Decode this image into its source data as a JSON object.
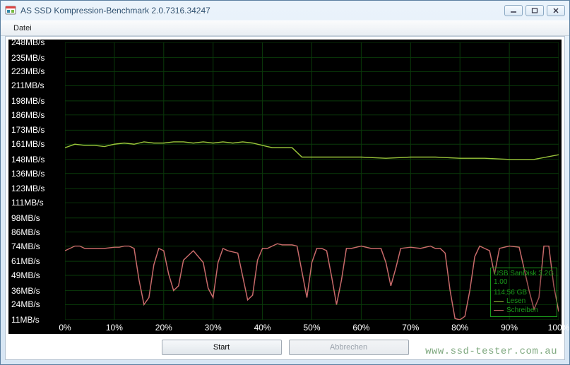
{
  "window": {
    "title": "AS SSD Kompression-Benchmark 2.0.7316.34247"
  },
  "menu": {
    "file": "Datei"
  },
  "buttons": {
    "start": "Start",
    "abort": "Abbrechen"
  },
  "legend": {
    "device": "USB  SanDisk 3.2G",
    "firmware": "1.00",
    "capacity": "114,56 GB",
    "read": "Lesen",
    "write": "Schreiben",
    "read_color": "#9ac53a",
    "write_color": "#c86a6a"
  },
  "watermark": "www.ssd-tester.com.au",
  "chart_data": {
    "type": "line",
    "xlabel": "",
    "ylabel": "",
    "x_unit": "%",
    "y_unit": "MB/s",
    "ylim": [
      11,
      248
    ],
    "xlim": [
      0,
      100
    ],
    "y_ticks": [
      11,
      24,
      36,
      49,
      61,
      74,
      86,
      98,
      111,
      123,
      136,
      148,
      161,
      173,
      186,
      198,
      211,
      223,
      235,
      248
    ],
    "y_tick_labels": [
      "11MB/s",
      "24MB/s",
      "36MB/s",
      "49MB/s",
      "61MB/s",
      "74MB/s",
      "86MB/s",
      "98MB/s",
      "111MB/s",
      "123MB/s",
      "136MB/s",
      "148MB/s",
      "161MB/s",
      "173MB/s",
      "186MB/s",
      "198MB/s",
      "211MB/s",
      "223MB/s",
      "235MB/s",
      "248MB/s"
    ],
    "x_ticks": [
      0,
      10,
      20,
      30,
      40,
      50,
      60,
      70,
      80,
      90,
      100
    ],
    "x_tick_labels": [
      "0%",
      "10%",
      "20%",
      "30%",
      "40%",
      "50%",
      "60%",
      "70%",
      "80%",
      "90%",
      "100%"
    ],
    "series": [
      {
        "name": "Lesen",
        "color": "#9ac53a",
        "x": [
          0,
          2,
          4,
          6,
          8,
          10,
          12,
          14,
          16,
          18,
          20,
          22,
          24,
          26,
          28,
          30,
          32,
          34,
          36,
          38,
          40,
          42,
          44,
          46,
          48,
          50,
          55,
          60,
          65,
          70,
          75,
          80,
          85,
          90,
          95,
          100
        ],
        "values": [
          158,
          161,
          160,
          160,
          159,
          161,
          162,
          161,
          163,
          162,
          162,
          163,
          163,
          162,
          163,
          162,
          163,
          162,
          163,
          162,
          160,
          158,
          158,
          158,
          150,
          150,
          150,
          150,
          149,
          150,
          150,
          149,
          149,
          148,
          148,
          152
        ]
      },
      {
        "name": "Schreiben",
        "color": "#c86a6a",
        "x": [
          0,
          2,
          3,
          4,
          5,
          6,
          8,
          10,
          11,
          12,
          13,
          14,
          15,
          16,
          17,
          18,
          19,
          20,
          21,
          22,
          23,
          24,
          26,
          28,
          29,
          30,
          31,
          32,
          33,
          35,
          36,
          37,
          38,
          39,
          40,
          41,
          42,
          43,
          44,
          45,
          46,
          47,
          48,
          49,
          50,
          51,
          52,
          53,
          54,
          55,
          56,
          57,
          58,
          60,
          62,
          64,
          65,
          66,
          67,
          68,
          70,
          72,
          74,
          75,
          76,
          77,
          78,
          79,
          80,
          81,
          82,
          83,
          84,
          85,
          86,
          87,
          88,
          90,
          92,
          94,
          95,
          96,
          97,
          98,
          99,
          100
        ],
        "values": [
          70,
          74,
          74,
          72,
          72,
          72,
          72,
          73,
          73,
          74,
          74,
          72,
          45,
          24,
          30,
          58,
          72,
          70,
          50,
          36,
          40,
          62,
          70,
          60,
          38,
          30,
          60,
          72,
          70,
          68,
          48,
          28,
          32,
          62,
          72,
          72,
          74,
          76,
          75,
          75,
          75,
          74,
          52,
          30,
          60,
          72,
          72,
          70,
          48,
          24,
          45,
          72,
          72,
          74,
          72,
          72,
          60,
          40,
          55,
          72,
          73,
          72,
          74,
          72,
          72,
          68,
          36,
          12,
          11,
          14,
          36,
          65,
          74,
          72,
          70,
          50,
          72,
          74,
          73,
          36,
          20,
          30,
          74,
          74,
          40,
          18
        ]
      }
    ]
  }
}
